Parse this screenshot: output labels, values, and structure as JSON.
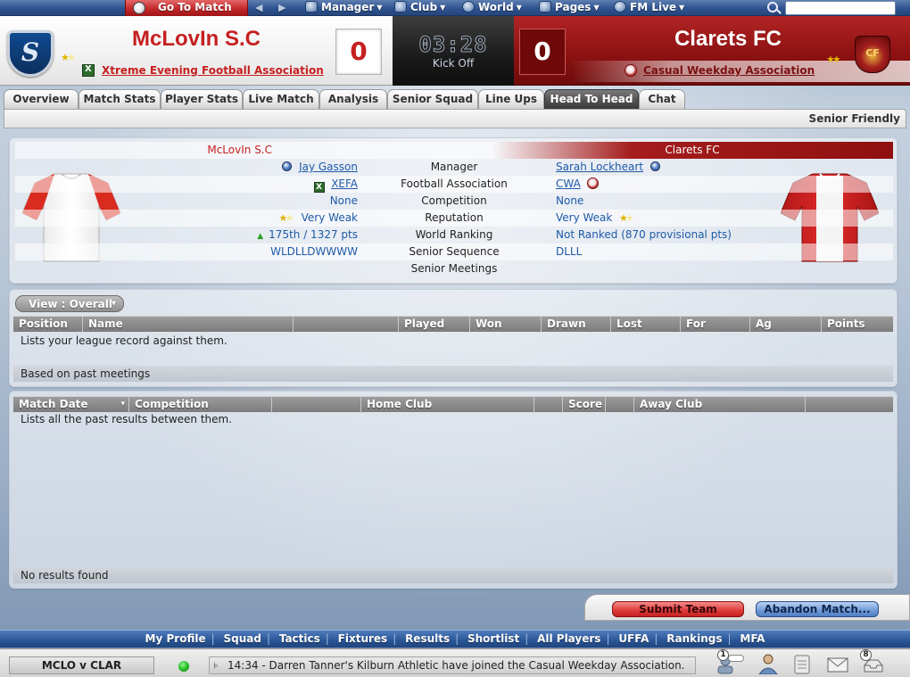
{
  "top_menu": {
    "go_to_match": "Go To Match",
    "manager": "Manager",
    "club": "Club",
    "world": "World",
    "pages": "Pages",
    "fm_live": "FM Live",
    "search_value": ""
  },
  "scoreboard": {
    "home": {
      "name": "McLovIn S.C",
      "score": "0",
      "association": "Xtreme Evening Football Association"
    },
    "away": {
      "name": "Clarets FC",
      "score": "0",
      "association": "Casual Weekday Association"
    },
    "clock": "03:28",
    "status": "Kick Off"
  },
  "tabs": [
    {
      "label": "Overview",
      "active": false
    },
    {
      "label": "Match Stats",
      "active": false
    },
    {
      "label": "Player Stats",
      "active": false
    },
    {
      "label": "Live Match",
      "active": false
    },
    {
      "label": "Analysis",
      "active": false
    },
    {
      "label": "Senior Squad",
      "active": false
    },
    {
      "label": "Line Ups",
      "active": false
    },
    {
      "label": "Head To Head",
      "active": true
    },
    {
      "label": "Chat",
      "active": false
    }
  ],
  "subheader": "Senior Friendly",
  "head_to_head": {
    "home_team": "McLovIn S.C",
    "away_team": "Clarets FC",
    "rows": [
      {
        "label": "Manager",
        "home": "Jay Gasson",
        "away": "Sarah Lockheart"
      },
      {
        "label": "Football Association",
        "home": "XEFA",
        "away": "CWA"
      },
      {
        "label": "Competition",
        "home": "None",
        "away": "None"
      },
      {
        "label": "Reputation",
        "home": "Very Weak",
        "away": "Very Weak"
      },
      {
        "label": "World Ranking",
        "home": "175th / 1327 pts",
        "away": "Not Ranked (870 provisional pts)"
      },
      {
        "label": "Senior Sequence",
        "home": "WLDLLDWWWW",
        "away": "DLLL"
      },
      {
        "label": "Senior Meetings",
        "home": "",
        "away": ""
      }
    ]
  },
  "league_record": {
    "view_label": "View : Overall",
    "columns": [
      "Position",
      "Name",
      "Played",
      "Won",
      "Drawn",
      "Lost",
      "For",
      "Ag",
      "Points"
    ],
    "empty_message": "Lists your league record against them.",
    "footer": "Based on past meetings"
  },
  "past_results": {
    "columns": [
      "Match Date",
      "Competition",
      "Home Club",
      "Score",
      "Away Club"
    ],
    "empty_message": "Lists all the past results between them.",
    "footer": "No results found"
  },
  "buttons": {
    "submit": "Submit Team",
    "abandon": "Abandon Match..."
  },
  "footer_nav": [
    "My Profile",
    "Squad",
    "Tactics",
    "Fixtures",
    "Results",
    "Shortlist",
    "All Players",
    "UFFA",
    "Rankings",
    "MFA"
  ],
  "status_bar": {
    "match": "MCLO v CLAR",
    "news": "14:34 - Darren Tanner's Kilburn Athletic have joined the Casual Weekday Association.",
    "badge_left": "1",
    "badge_right": "8"
  },
  "colors": {
    "home_red": "#c62020",
    "away_maroon": "#8e1212",
    "link_blue": "#1d5aa8",
    "menu_blue": "#2f5390"
  }
}
